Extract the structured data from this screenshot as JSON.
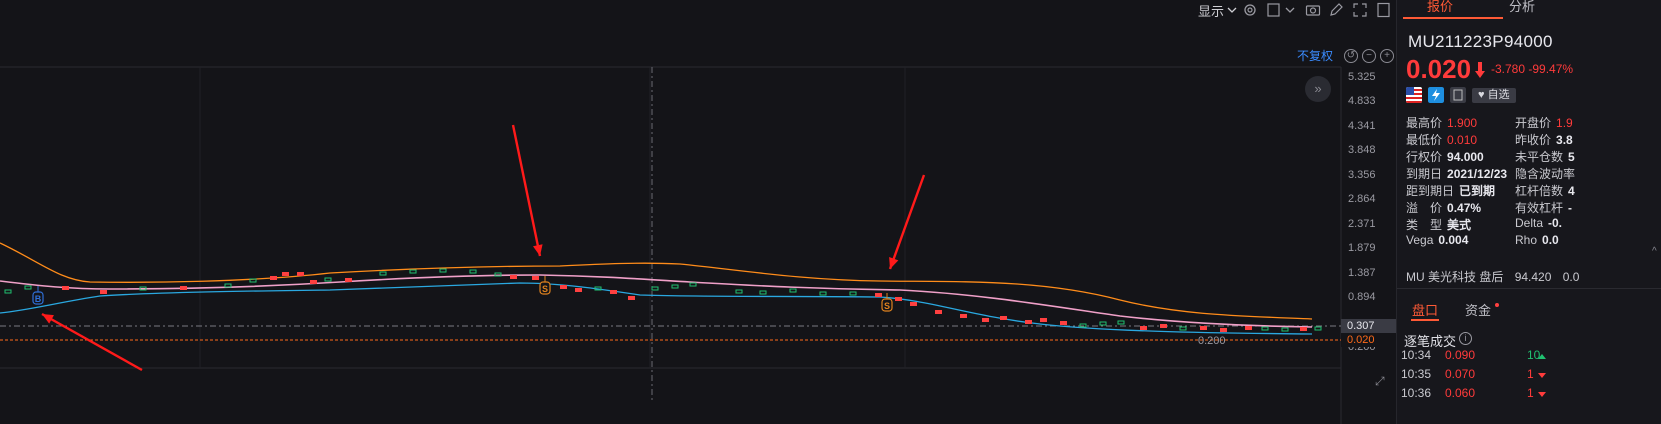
{
  "toolbar": {
    "display_label": "显示",
    "icons": [
      "chevron-down-icon",
      "gear-icon",
      "square-icon",
      "chevron-down-icon",
      "camera-icon",
      "pencil-icon",
      "fullscreen-icon",
      "window-icon"
    ]
  },
  "chart": {
    "adjust_label": "不复权",
    "collapse_symbol": "»",
    "y_ticks": [
      "5.325",
      "4.833",
      "4.341",
      "3.848",
      "3.356",
      "2.864",
      "2.371",
      "1.879",
      "1.387",
      "0.894",
      "0.307",
      "0.020",
      "0.200"
    ],
    "current_price_tag": "0.307",
    "last_price_tag": "0.020",
    "low_marker_label": "0.200",
    "markers": [
      {
        "label": "B",
        "color": "#2f6fd8"
      },
      {
        "label": "S",
        "color": "#e0821e"
      },
      {
        "label": "S",
        "color": "#e0821e"
      }
    ],
    "colors": {
      "upper_band": "#ff8c1a",
      "middle_band": "#f0a0c8",
      "lower_band": "#2aa8e0",
      "up_candle": "#ff4040",
      "down_candle": "#20c070",
      "annotation_arrow": "#ff1a1a",
      "last_price_line": "#ff6a1a"
    }
  },
  "quote": {
    "tabs": [
      "报价",
      "分析"
    ],
    "symbol": "MU211223P94000",
    "price": "0.020",
    "change": "-3.780",
    "change_pct": "-99.47%",
    "watch_label": "自选",
    "fields_left": [
      {
        "k": "最高价",
        "v": "1.900",
        "style": "red"
      },
      {
        "k": "最低价",
        "v": "0.010",
        "style": "red"
      },
      {
        "k": "行权价",
        "v": "94.000",
        "style": "white"
      },
      {
        "k": "到期日",
        "v": "2021/12/23",
        "style": "white"
      },
      {
        "k": "距到期日",
        "v": "已到期",
        "style": "white"
      },
      {
        "k": "溢　价",
        "v": "0.47%",
        "style": "white"
      },
      {
        "k": "类　型",
        "v": "美式",
        "style": "white"
      },
      {
        "k": "Vega",
        "v": "0.004",
        "style": "white"
      }
    ],
    "fields_right": [
      {
        "k": "开盘价",
        "v": "1.9",
        "style": "red"
      },
      {
        "k": "昨收价",
        "v": "3.8",
        "style": "white"
      },
      {
        "k": "未平仓数",
        "v": "5",
        "style": "white"
      },
      {
        "k": "隐含波动率",
        "v": "",
        "style": "white"
      },
      {
        "k": "杠杆倍数",
        "v": "4",
        "style": "white"
      },
      {
        "k": "有效杠杆",
        "v": "-",
        "style": "white"
      },
      {
        "k": "Delta",
        "v": "-0.",
        "style": "white"
      },
      {
        "k": "Rho",
        "v": "0.0",
        "style": "white"
      }
    ],
    "underlying": "MU 美光科技 盘后",
    "underlying_price": "94.420",
    "underlying_change": "0.0"
  },
  "lower": {
    "tabs": [
      "盘口",
      "资金"
    ],
    "tick_title": "逐笔成交",
    "ticks": [
      {
        "time": "10:34",
        "price": "0.090",
        "qty": "10",
        "dir": "up"
      },
      {
        "time": "10:35",
        "price": "0.070",
        "qty": "1",
        "dir": "down"
      },
      {
        "time": "10:36",
        "price": "0.060",
        "qty": "1",
        "dir": "down"
      }
    ]
  }
}
